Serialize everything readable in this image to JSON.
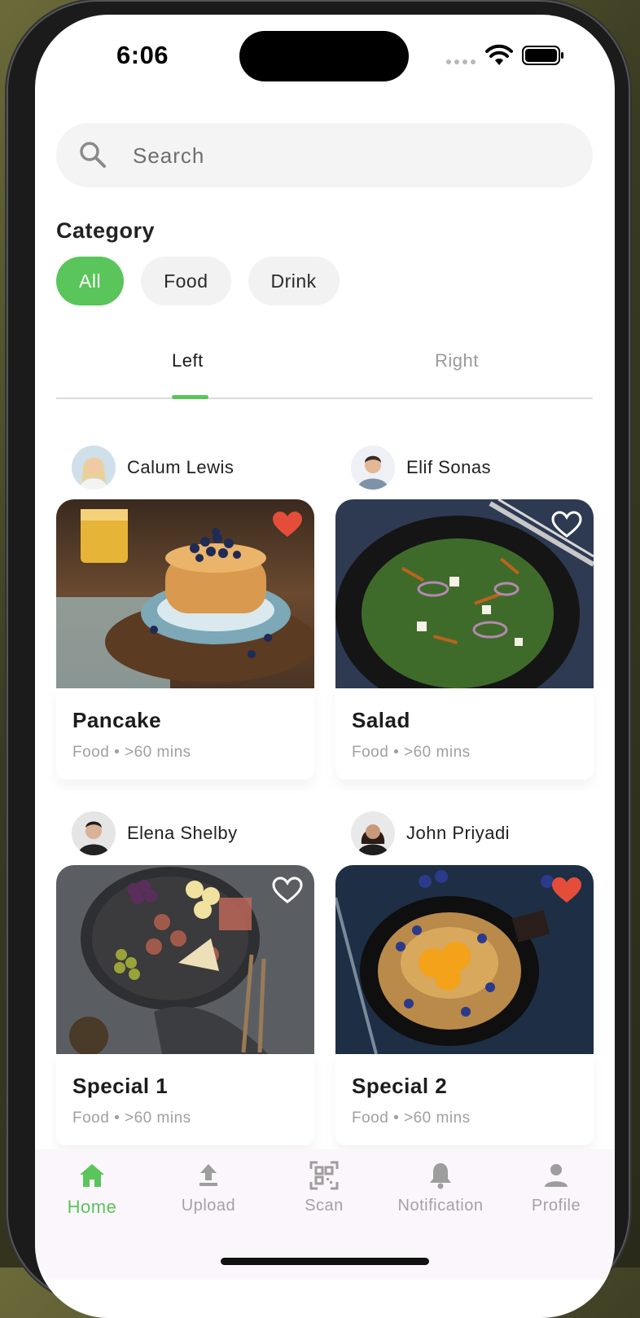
{
  "status_bar": {
    "time": "6:06"
  },
  "search": {
    "placeholder": "Search",
    "icon": "search-icon"
  },
  "category": {
    "title": "Category",
    "chips": [
      {
        "label": "All",
        "active": true
      },
      {
        "label": "Food",
        "active": false
      },
      {
        "label": "Drink",
        "active": false
      }
    ]
  },
  "tabs": [
    {
      "label": "Left",
      "active": true
    },
    {
      "label": "Right",
      "active": false
    }
  ],
  "cards": [
    {
      "author": "Calum Lewis",
      "title": "Pancake",
      "category": "Food",
      "duration": ">60 mins",
      "meta": "Food • >60 mins",
      "liked": true
    },
    {
      "author": "Elif Sonas",
      "title": "Salad",
      "category": "Food",
      "duration": ">60 mins",
      "meta": "Food • >60 mins",
      "liked": false
    },
    {
      "author": "Elena Shelby",
      "title": "Special 1",
      "category": "Food",
      "duration": ">60 mins",
      "meta": "Food • >60 mins",
      "liked": false
    },
    {
      "author": "John Priyadi",
      "title": "Special 2",
      "category": "Food",
      "duration": ">60 mins",
      "meta": "Food • >60 mins",
      "liked": true
    }
  ],
  "nav": [
    {
      "label": "Home",
      "icon": "home-icon",
      "active": true
    },
    {
      "label": "Upload",
      "icon": "upload-icon",
      "active": false
    },
    {
      "label": "Scan",
      "icon": "qr-scan-icon",
      "active": false
    },
    {
      "label": "Notification",
      "icon": "bell-icon",
      "active": false
    },
    {
      "label": "Profile",
      "icon": "person-icon",
      "active": false
    }
  ],
  "colors": {
    "accent": "#59c55a",
    "heart_liked": "#e44d3a",
    "chip_bg": "#f2f2f2"
  }
}
